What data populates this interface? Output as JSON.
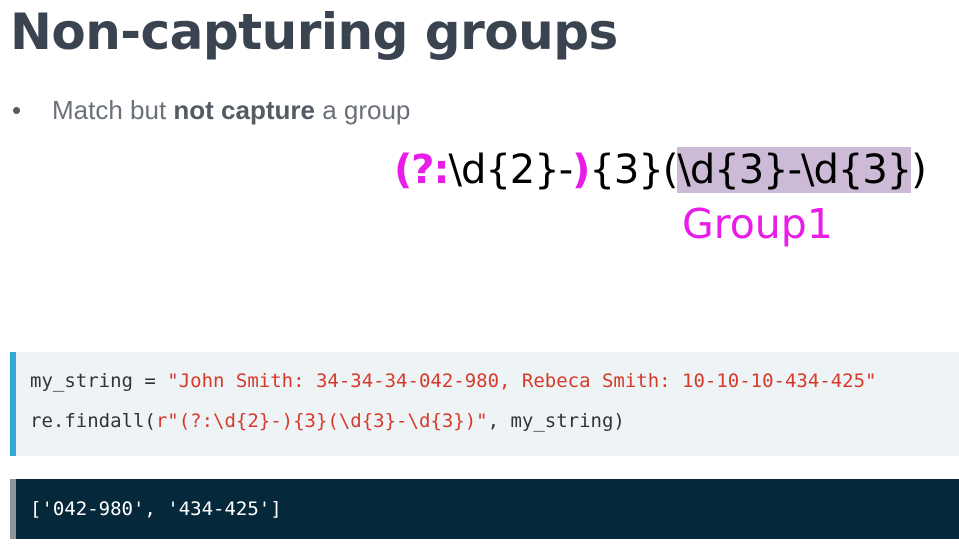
{
  "slide": {
    "title": "Non-capturing groups",
    "bullet": {
      "prefix": "Match but ",
      "bold": "not capture",
      "suffix": " a group"
    }
  },
  "regex_diagram": {
    "noncap_open": "(?:",
    "noncap_body": "\\d{2}-",
    "noncap_close": ")",
    "quantifier": "{3}",
    "group_open": "(",
    "group_body": "\\d{3}-\\d{3}",
    "group_close": ")",
    "group_label": "Group1",
    "accent_color": "#e91de9",
    "highlight_color": "#cdbad6"
  },
  "code": {
    "line1": {
      "code": "my_string = ",
      "string": "\"John Smith: 34-34-34-042-980, Rebeca Smith: 10-10-10-434-425\""
    },
    "line2": {
      "code_before": "re.findall(",
      "string": "r\"(?:\\d{2}-){3}(\\d{3}-\\d{3})\"",
      "code_after": ", my_string)"
    }
  },
  "output": {
    "text": "['042-980', '434-425']"
  }
}
